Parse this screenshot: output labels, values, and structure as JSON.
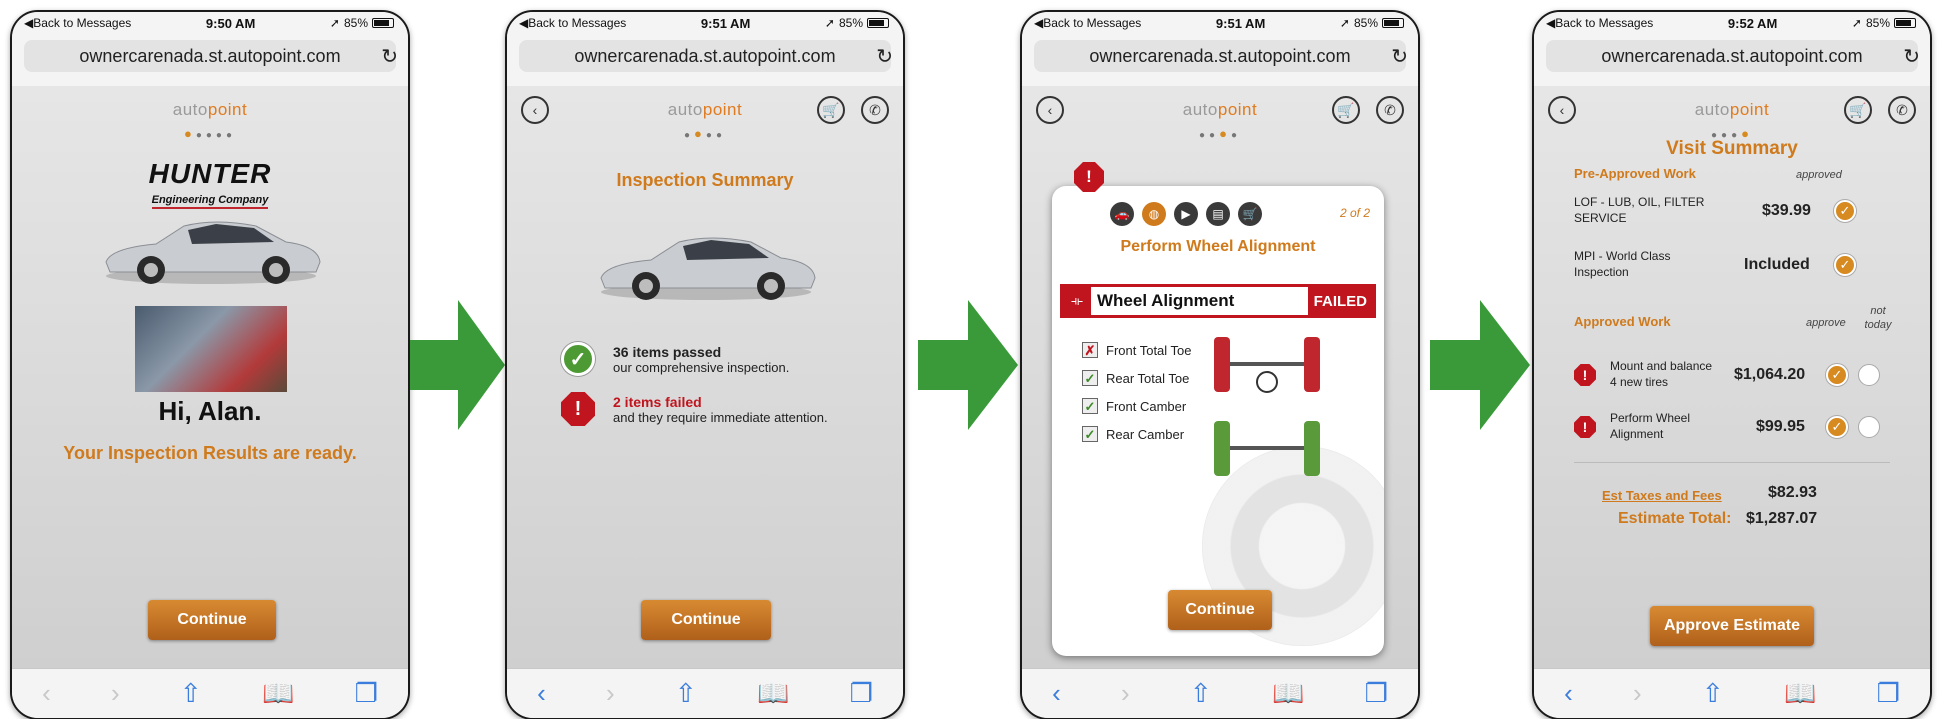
{
  "status_bars": [
    {
      "back": "Back to Messages",
      "time": "9:50 AM",
      "battery": "85%"
    },
    {
      "back": "Back to Messages",
      "time": "9:51 AM",
      "battery": "85%"
    },
    {
      "back": "Back to Messages",
      "time": "9:51 AM",
      "battery": "85%"
    },
    {
      "back": "Back to Messages",
      "time": "9:52 AM",
      "battery": "85%"
    }
  ],
  "url": "ownercarenada.st.autopoint.com",
  "brand": {
    "auto": "auto",
    "point": "point"
  },
  "screen1": {
    "logo_main": "HUNTER",
    "logo_sub": "Engineering Company",
    "greeting": "Hi, Alan.",
    "results": "Your Inspection Results are ready.",
    "continue": "Continue"
  },
  "screen2": {
    "title": "Inspection Summary",
    "passed_title": "36 items passed",
    "passed_sub": "our comprehensive inspection.",
    "failed_title": "2 items failed",
    "failed_sub": "and they require immediate attention.",
    "continue": "Continue"
  },
  "screen3": {
    "pager": "2 of 2",
    "title": "Perform Wheel Alignment",
    "item": "Wheel Alignment",
    "status": "FAILED",
    "checks": [
      {
        "label": "Front Total Toe",
        "state": "fail"
      },
      {
        "label": "Rear Total Toe",
        "state": "pass"
      },
      {
        "label": "Front Camber",
        "state": "pass"
      },
      {
        "label": "Rear Camber",
        "state": "pass"
      }
    ],
    "continue": "Continue"
  },
  "screen4": {
    "title": "Visit Summary",
    "pre_approved": "Pre-Approved Work",
    "approved_col": "approved",
    "lof_label": "LOF - LUB, OIL, FILTER SERVICE",
    "lof_price": "$39.99",
    "mpi_label": "MPI - World Class Inspection",
    "mpi_price": "Included",
    "approved_work": "Approved Work",
    "approve_col": "approve",
    "not_today_col": "not today",
    "tires_label": "Mount and balance 4 new tires",
    "tires_price": "$1,064.20",
    "align_label": "Perform Wheel Alignment",
    "align_price": "$99.95",
    "taxes_label": "Est Taxes and Fees",
    "taxes_value": "$82.93",
    "total_label": "Estimate Total:",
    "total_value": "$1,287.07",
    "approve_button": "Approve Estimate"
  },
  "colors": {
    "accent": "#cf7a1c",
    "alert": "#c0151e",
    "pass": "#4d9a35",
    "arrow": "#3a9a3a"
  }
}
